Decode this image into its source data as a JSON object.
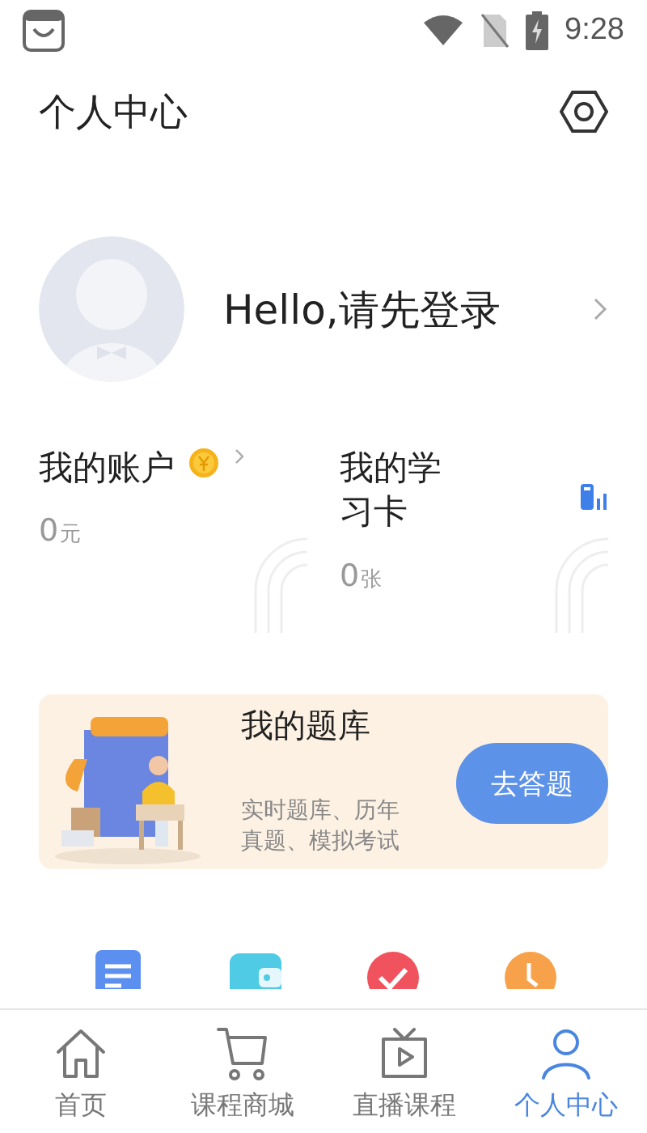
{
  "status_bar": {
    "time": "9:28"
  },
  "header": {
    "title": "个人中心"
  },
  "profile": {
    "greeting": "Hello,请先登录"
  },
  "cards": [
    {
      "kind": "account",
      "title": "我的账户",
      "value": "0",
      "unit": "元"
    },
    {
      "kind": "study_card",
      "title": "我的学习卡",
      "value": "0",
      "unit": "张"
    }
  ],
  "banner": {
    "title": "我的题库",
    "description": "实时题库、历年真题、模拟考试",
    "button": "去答题"
  },
  "shortcuts": [
    {
      "kind": "document",
      "color": "#5b8ff0"
    },
    {
      "kind": "wallet",
      "color": "#4fcbe6"
    },
    {
      "kind": "check",
      "color": "#f0525e"
    },
    {
      "kind": "clock",
      "color": "#f7a24a"
    }
  ],
  "tab_bar": [
    {
      "kind": "home",
      "label": "首页",
      "selected": false
    },
    {
      "kind": "cart",
      "label": "课程商城",
      "selected": false
    },
    {
      "kind": "tv",
      "label": "直播课程",
      "selected": false
    },
    {
      "kind": "person",
      "label": "个人中心",
      "selected": true
    }
  ]
}
